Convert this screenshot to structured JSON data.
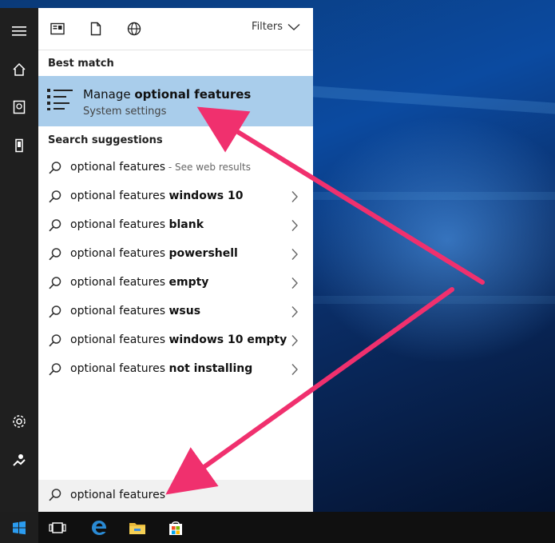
{
  "toolbar": {
    "filters_label": "Filters"
  },
  "best_match": {
    "heading": "Best match",
    "title_normal": "Manage ",
    "title_bold": "optional features",
    "subtitle": "System settings"
  },
  "suggestions": {
    "heading": "Search suggestions",
    "items": [
      {
        "prefix": "optional features",
        "suffix": "",
        "hint": " - See web results"
      },
      {
        "prefix": "optional features ",
        "suffix": "windows 10",
        "hint": ""
      },
      {
        "prefix": "optional features ",
        "suffix": "blank",
        "hint": ""
      },
      {
        "prefix": "optional features ",
        "suffix": "powershell",
        "hint": ""
      },
      {
        "prefix": "optional features ",
        "suffix": "empty",
        "hint": ""
      },
      {
        "prefix": "optional features ",
        "suffix": "wsus",
        "hint": ""
      },
      {
        "prefix": "optional features ",
        "suffix": "windows 10 empty",
        "hint": ""
      },
      {
        "prefix": "optional features ",
        "suffix": "not installing",
        "hint": ""
      }
    ]
  },
  "search": {
    "value": "optional features"
  },
  "colors": {
    "arrow": "#f0306e",
    "highlight": "#a9cdeb",
    "rail": "#1f1f1f",
    "taskbar": "#101010"
  },
  "icons": {
    "rail": [
      "hamburger-icon",
      "home-icon",
      "notebook-icon",
      "device-icon",
      "settings-icon",
      "feedback-icon"
    ],
    "toolbar": [
      "apps-icon",
      "document-icon",
      "web-icon"
    ],
    "taskbar": [
      "windows-start-icon",
      "task-view-icon",
      "edge-icon",
      "file-explorer-icon",
      "store-icon"
    ]
  }
}
